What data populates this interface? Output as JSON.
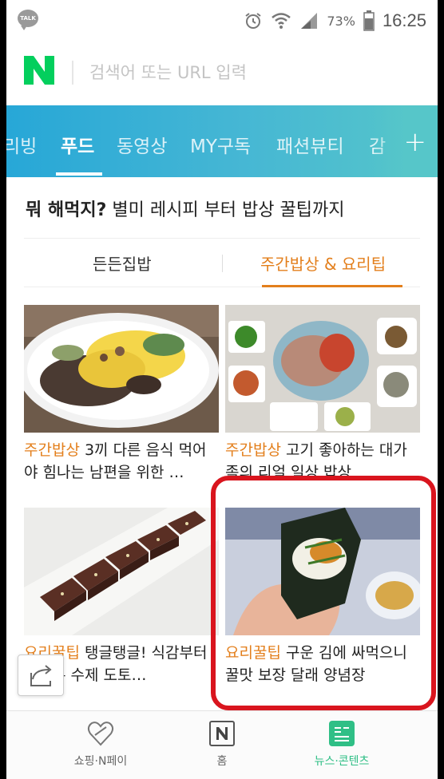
{
  "status_bar": {
    "app_badge": "TALK",
    "battery": "73%",
    "time": "16:25"
  },
  "search": {
    "placeholder": "검색어 또는 URL 입력"
  },
  "tabs": [
    {
      "label": "리빙"
    },
    {
      "label": "푸드"
    },
    {
      "label": "동영상"
    },
    {
      "label": "MY구독"
    },
    {
      "label": "패션뷰티"
    },
    {
      "label": "감"
    }
  ],
  "tabs_active": "푸드",
  "headline": {
    "lead": "뭐 해먹지?",
    "rest": " 별미 레시피 부터 밥상 꿀팁까지"
  },
  "subtabs": [
    {
      "label": "든든집밥"
    },
    {
      "label": "주간밥상 & 요리팁"
    }
  ],
  "cards": [
    {
      "category": "주간밥상",
      "title": " 3끼 다른 음식 먹어야 힘나는 남편을 위한 …"
    },
    {
      "category": "주간밥상",
      "title": " 고기 좋아하는 대가족의 리얼 일상 밥상"
    },
    {
      "category": "요리꿀팁",
      "title": " 탱글탱글! 식감부터 남다른 수제 도토…"
    },
    {
      "category": "요리꿀팁",
      "title": " 구운 김에 싸먹으니 꿀맛 보장 달래 양념장"
    }
  ],
  "bottom_nav": [
    {
      "label": "쇼핑·N페이",
      "icon": "heart-pay-icon"
    },
    {
      "label": "홈",
      "icon": "naver-n-icon"
    },
    {
      "label": "뉴스·콘텐츠",
      "icon": "news-icon"
    }
  ],
  "colors": {
    "brand_green": "#03cf5d",
    "tab_gradient_start": "#27a7d7",
    "tab_gradient_end": "#56c6c9",
    "accent_orange": "#e37f1c",
    "highlight_red": "#d9151e",
    "active_nav_green": "#2fbf86"
  }
}
